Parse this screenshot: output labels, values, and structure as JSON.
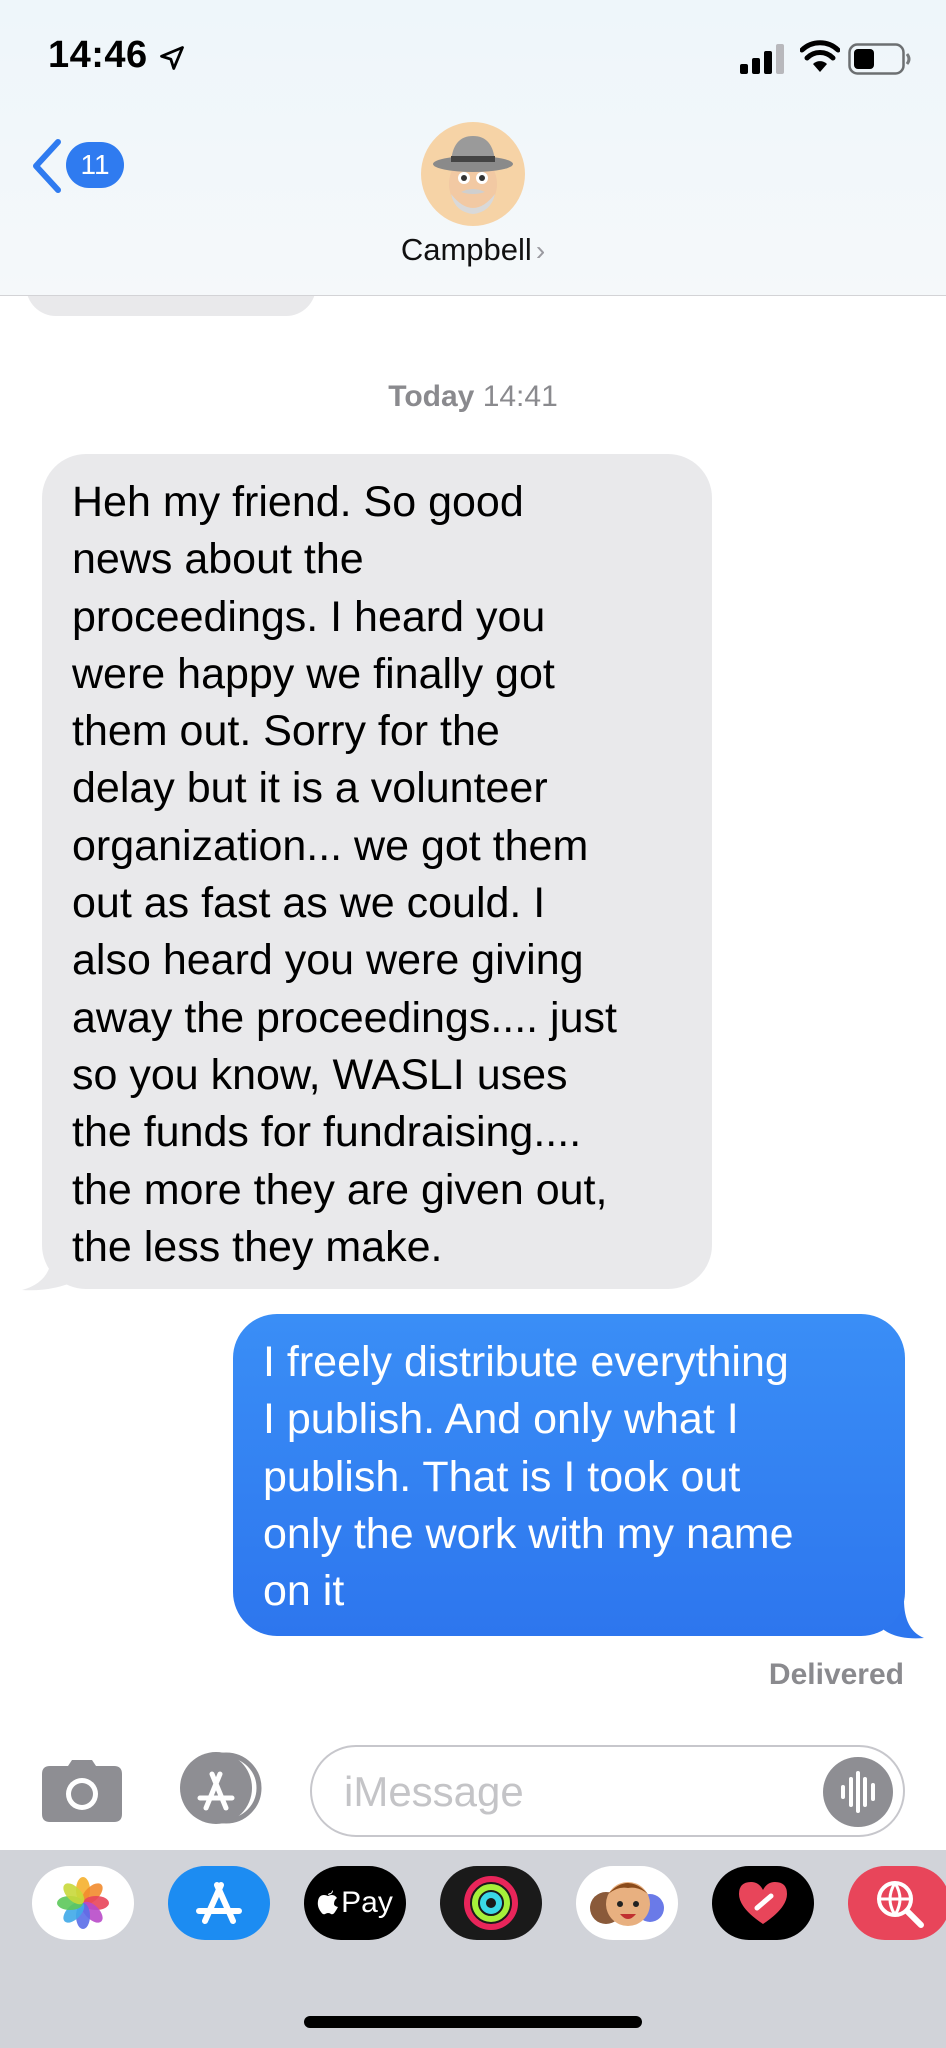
{
  "status_bar": {
    "time": "14:46",
    "icons": [
      "location-arrow-icon",
      "cellular-signal-icon",
      "wifi-icon",
      "battery-icon"
    ]
  },
  "header": {
    "back_badge": "11",
    "contact_name": "Campbell",
    "contact_chevron": "›"
  },
  "conversation": {
    "timestamp_day": "Today",
    "timestamp_time": "14:41",
    "incoming_lines": [
      "Heh my friend.  So good",
      "news about the",
      "proceedings.  I heard you",
      "were happy we finally got",
      "them out.  Sorry for the",
      "delay but it is a volunteer",
      "organization... we got them",
      "out as fast as we could.  I",
      "also heard you were giving",
      "away the proceedings.... just",
      "so you know, WASLI uses",
      "the funds for fundraising....",
      "the more they are given out,",
      "the less they make."
    ],
    "outgoing_lines": [
      "I freely distribute everything",
      "I publish. And only what I",
      "publish. That is I took out",
      "only the work with my name",
      "on it"
    ],
    "delivery_status": "Delivered"
  },
  "compose": {
    "placeholder": "iMessage",
    "value": ""
  },
  "app_drawer": {
    "apps": [
      {
        "name": "photos-app-icon",
        "bg": "#ffffff"
      },
      {
        "name": "app-store-icon",
        "bg": "#1c8cf2"
      },
      {
        "name": "apple-pay-icon",
        "bg": "#000000",
        "label": "Pay"
      },
      {
        "name": "activity-app-icon",
        "bg": "#1a1a1a"
      },
      {
        "name": "memoji-stickers-icon",
        "bg": "#ffffff"
      },
      {
        "name": "digital-touch-icon",
        "bg": "#000000"
      },
      {
        "name": "web-images-search-icon",
        "bg": "#e8455a"
      }
    ]
  },
  "colors": {
    "accent_blue": "#2f7bf0",
    "incoming_bubble": "#e9e9eb",
    "outgoing_bubble": "#3a8ef6"
  }
}
